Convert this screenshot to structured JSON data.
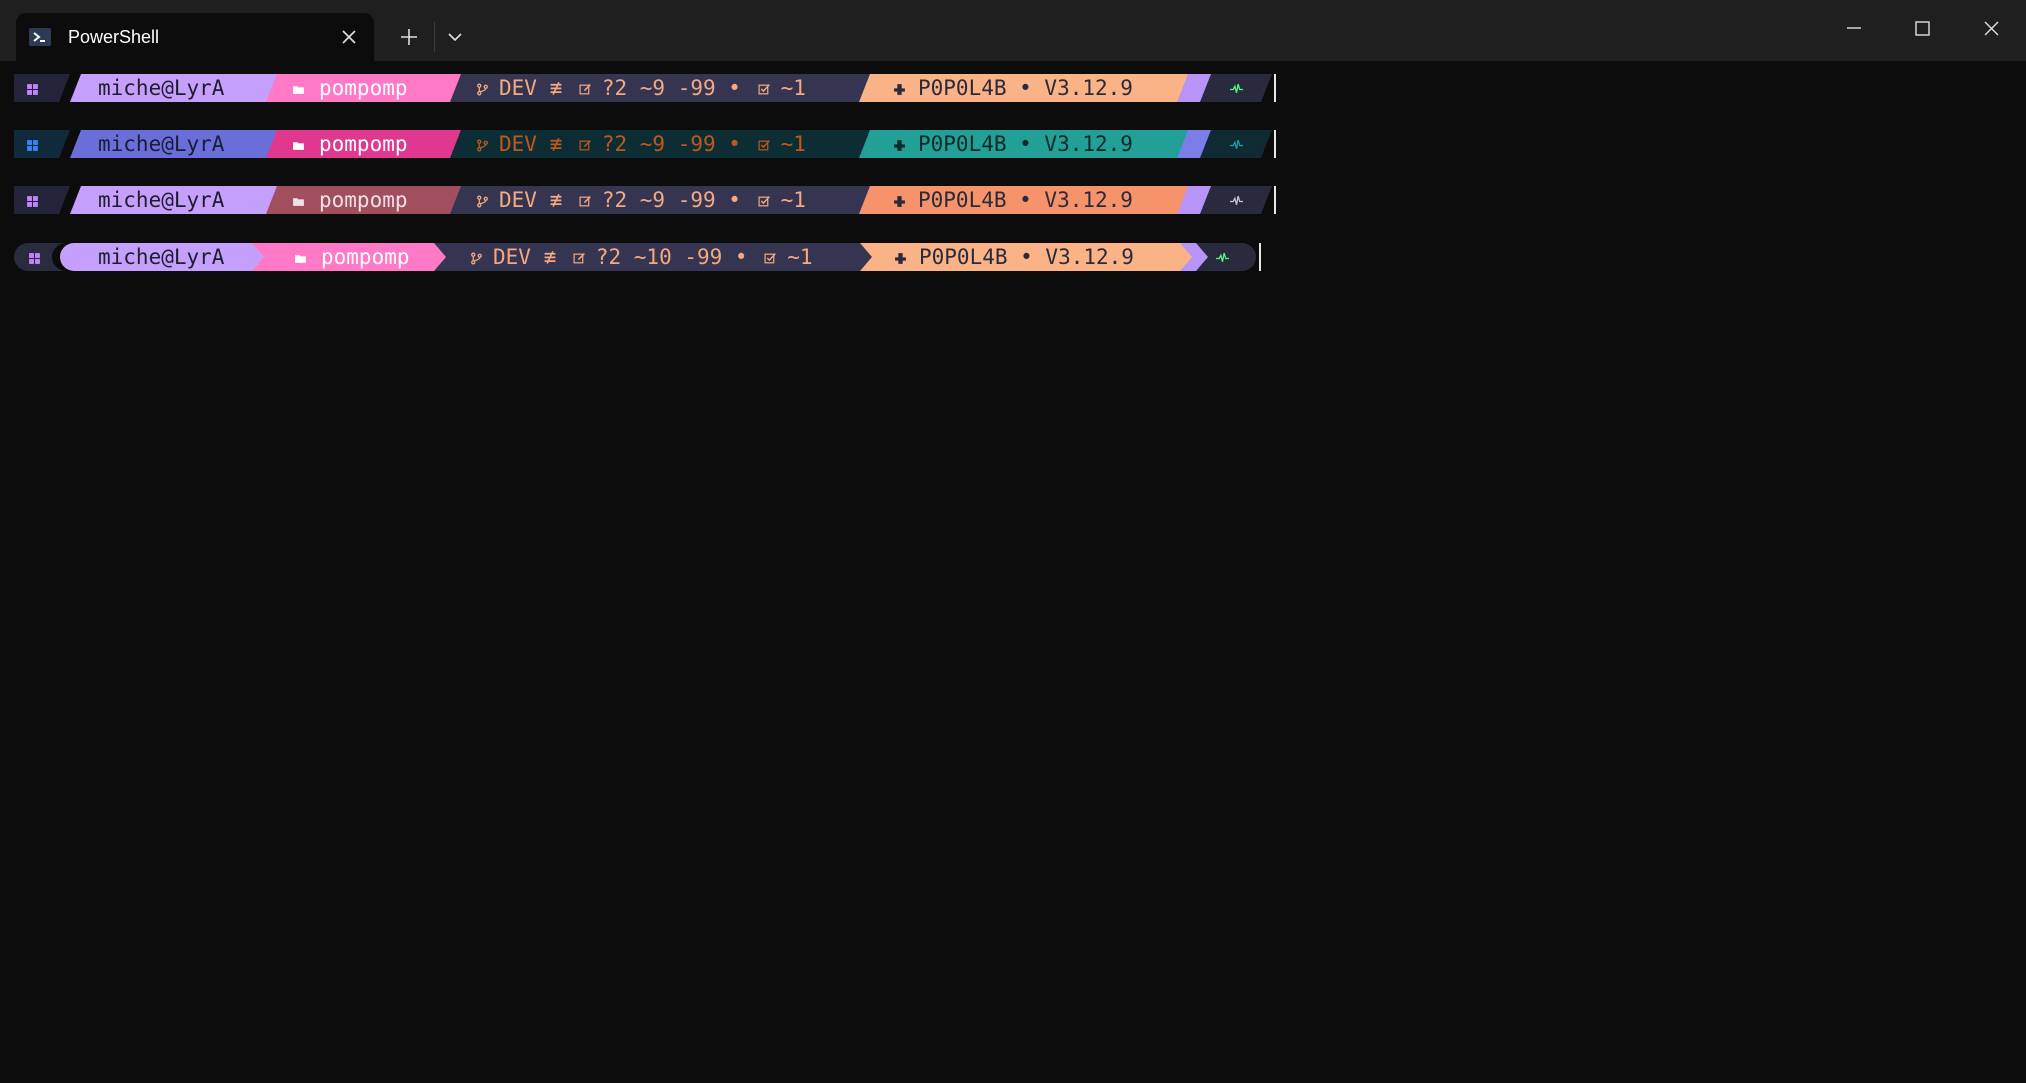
{
  "window": {
    "tab_title": "PowerShell"
  },
  "icons": {
    "tab": "powershell-icon",
    "close": "close-icon",
    "new_tab": "plus-icon",
    "dropdown": "chevron-down-icon",
    "minimize": "minimize-icon",
    "maximize": "maximize-icon",
    "window_close": "close-icon",
    "os": "windows-icon",
    "folder": "folder-icon",
    "branch": "git-branch-icon",
    "edit": "edit-icon",
    "check": "checkbox-icon",
    "python": "python-icon",
    "exec": "exec-icon"
  },
  "prompts": [
    {
      "user": "miche@LyrA",
      "dir": "pompomp",
      "git": "DEV ≢ ",
      "git_changes": "?2 ~9 -99 • ",
      "git_staged": "~1",
      "env": "P0P0L4B • V3.12.9",
      "colors": {
        "os_bg": "#23233a",
        "os_fg": "#c084fc",
        "user_bg": "#c4a0fc",
        "user_fg": "#1e1e2e",
        "dir_bg": "#ff79c6",
        "dir_fg": "#ffffff",
        "git_bg": "#353552",
        "git_fg": "#f5a97f",
        "env_bg": "#fab387",
        "env_fg": "#2a2a3c",
        "tail1_bg": "#b794f6",
        "tail2_bg": "#2a2a3f",
        "exec_fg": "#50fa7b"
      }
    },
    {
      "user": "miche@LyrA",
      "dir": "pompomp",
      "git": "DEV ≢ ",
      "git_changes": "?2 ~9 -99 • ",
      "git_staged": "~1",
      "env": "P0P0L4B • V3.12.9",
      "colors": {
        "os_bg": "#0f2a3a",
        "os_fg": "#3b82f6",
        "user_bg": "#6a6ed8",
        "user_fg": "#1b1b3a",
        "dir_bg": "#e0388e",
        "dir_fg": "#ffffff",
        "git_bg": "#0d2d35",
        "git_fg": "#c2571a",
        "env_bg": "#229f96",
        "env_fg": "#0b2a2a",
        "tail1_bg": "#7a7ee6",
        "tail2_bg": "#102a33",
        "exec_fg": "#1f9f9f"
      }
    },
    {
      "user": "miche@LyrA",
      "dir": "pompomp",
      "git": "DEV ≢ ",
      "git_changes": "?2 ~9 -99 • ",
      "git_staged": "~1",
      "env": "P0P0L4B • V3.12.9",
      "colors": {
        "os_bg": "#23233a",
        "os_fg": "#c084fc",
        "user_bg": "#c4a0fc",
        "user_fg": "#1e1e2e",
        "dir_bg": "#a14e5e",
        "dir_fg": "#f0e0ea",
        "git_bg": "#353552",
        "git_fg": "#f5a97f",
        "env_bg": "#f7936a",
        "env_fg": "#2a2a3c",
        "tail1_bg": "#b794f6",
        "tail2_bg": "#2a2a3f",
        "exec_fg": "#c4c4e0"
      }
    },
    {
      "user": "miche@LyrA",
      "dir": "pompomp",
      "git": "DEV ≢ ",
      "git_changes": "?2 ~10 -99 • ",
      "git_staged": "~1",
      "env": "P0P0L4B • V3.12.9",
      "colors": {
        "os_bg": "#2b2b40",
        "os_fg": "#c084fc",
        "user_bg": "#c4a0fc",
        "user_fg": "#1e1e2e",
        "dir_bg": "#ff79c6",
        "dir_fg": "#ffffff",
        "git_bg": "#353552",
        "git_fg": "#f5a97f",
        "env_bg": "#fab387",
        "env_fg": "#2a2a3c",
        "tail1_bg": "#b794f6",
        "tail2_bg": "#2a2a3f",
        "exec_fg": "#50fa7b"
      }
    }
  ]
}
